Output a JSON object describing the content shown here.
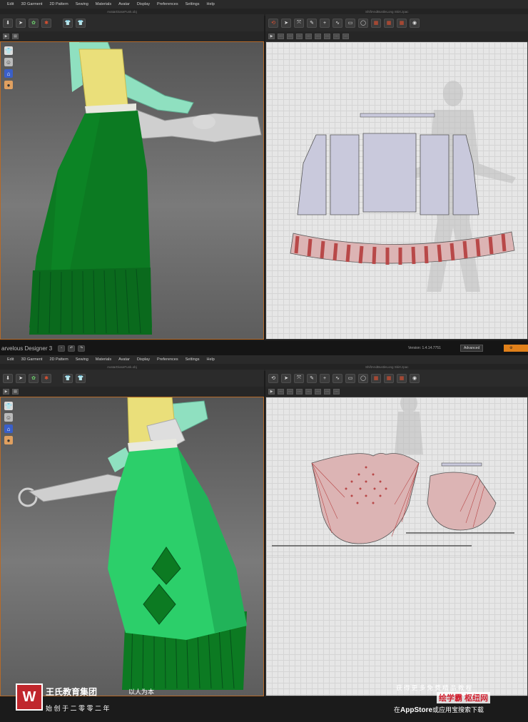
{
  "menu": [
    "Edit",
    "3D Garment",
    "2D Pattern",
    "Sewing",
    "Materials",
    "Avatar",
    "Display",
    "Preferences",
    "Settings",
    "Help"
  ],
  "top": {
    "window3d_title": "AvatarDiaseFunk.obj",
    "window2d_title": "ShiftAndBustleLong Skirt.zpac"
  },
  "bottom": {
    "app_logo": "arvelous Designer 3",
    "version_label": "Version:",
    "version_value": "1.4.14.7751",
    "advanced_label": "Advanced",
    "window3d_title": "AvatarDiaseFunk.obj",
    "window2d_title": "ShiftAndBustleLong Skirt.zpac"
  },
  "icons": {
    "side": [
      "shirt-icon",
      "avatar-icon",
      "hanger-icon",
      "head-icon"
    ],
    "toolbar3d": [
      "arrow-icon",
      "select-icon",
      "fold-icon",
      "pin-icon",
      "shirt-blue-icon",
      "shirt-blue-icon"
    ],
    "toolbar2d": [
      "sync-icon",
      "select-icon",
      "transform-icon",
      "edit-point-icon",
      "add-point-icon",
      "curve-icon",
      "rect-icon",
      "circle-icon",
      "seam-icon",
      "grid-icon",
      "grid2-icon",
      "camera-icon"
    ]
  },
  "colors": {
    "skirt_dark": "#0c7a22",
    "skirt_light": "#2ccf6a",
    "bodice": "#eadf7a",
    "sleeve": "#8fe0c0",
    "pattern_piece": "#c9c9dc",
    "pattern_piece_red": "#dcb4b4",
    "waistband_red": "#b84848",
    "accent_border": "#b56a2a"
  },
  "watermark": {
    "brand_cn": "王氏教育集团",
    "slogan_cn": "以人为本",
    "founded_cn": "始 创 于 二 零 零 二 年",
    "promo_line1": "获 得 更 多 免 费 精 品 教 程",
    "promo_site": "绘学霸 枢纽网",
    "promo_line2_a": "在",
    "promo_line2_b": "AppStore",
    "promo_line2_c": "或应用宝搜索下载"
  }
}
